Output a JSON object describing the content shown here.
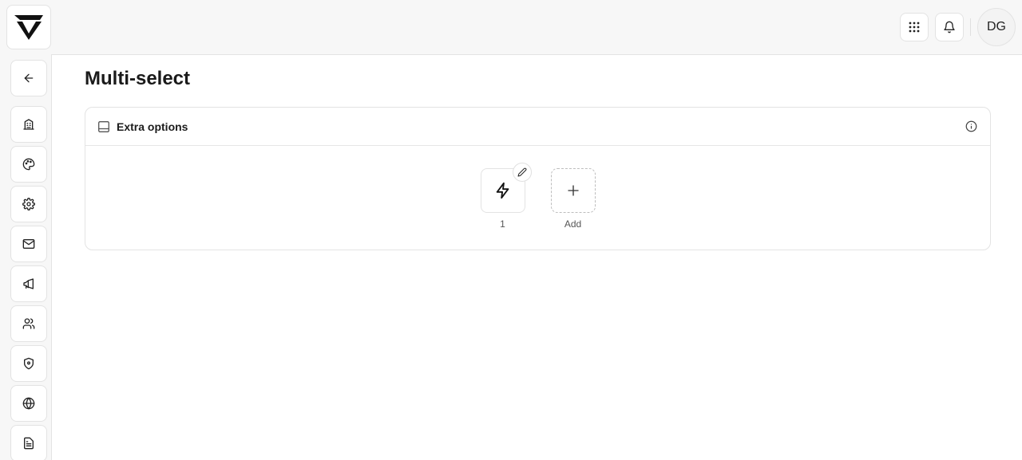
{
  "header": {
    "avatar_initials": "DG",
    "icons": [
      "grid-icon",
      "bell-icon"
    ]
  },
  "sidebar": {
    "items": [
      {
        "name": "back",
        "icon": "arrow-left-icon"
      },
      {
        "name": "building",
        "icon": "building-icon"
      },
      {
        "name": "palette",
        "icon": "palette-icon"
      },
      {
        "name": "settings",
        "icon": "gear-icon"
      },
      {
        "name": "mail",
        "icon": "mail-icon"
      },
      {
        "name": "announcements",
        "icon": "megaphone-icon"
      },
      {
        "name": "users",
        "icon": "users-icon"
      },
      {
        "name": "security",
        "icon": "shield-icon"
      },
      {
        "name": "globe",
        "icon": "globe-icon"
      },
      {
        "name": "documents",
        "icon": "document-icon"
      }
    ]
  },
  "main": {
    "title": "Multi-select",
    "card": {
      "title": "Extra options",
      "options": [
        {
          "label": "1",
          "icon": "lightning-icon"
        }
      ],
      "add_label": "Add"
    }
  },
  "colors": {
    "background": "#f7f7f7",
    "surface": "#ffffff",
    "border": "#e3e3e3",
    "text": "#1c1c1c"
  }
}
